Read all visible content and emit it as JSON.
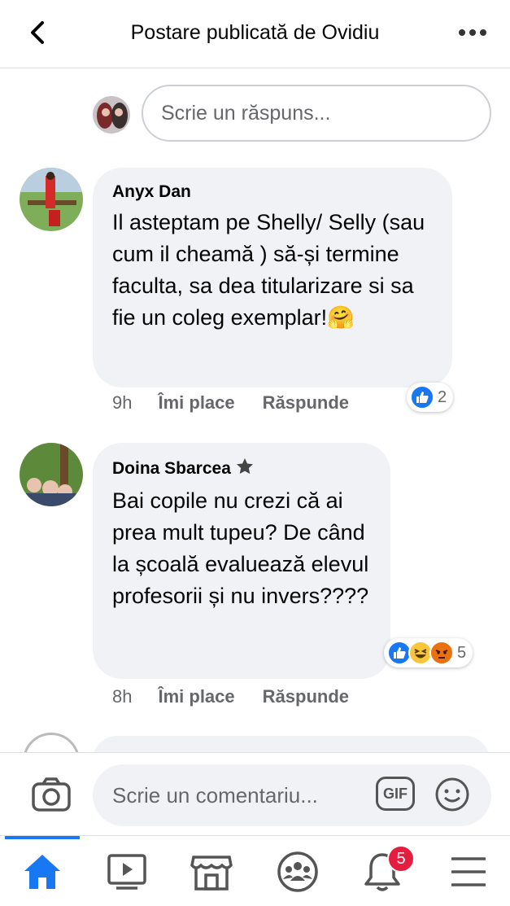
{
  "header": {
    "title": "Postare publicată de Ovidiu"
  },
  "reply": {
    "placeholder": "Scrie un răspuns..."
  },
  "comments": [
    {
      "author": "Anyx Dan",
      "text": "Il asteptam pe Shelly/ Selly (sau cum il cheamă ) să-și termine faculta, sa dea titularizare si sa fie un coleg exemplar!🤗",
      "time": "9h",
      "like_label": "Îmi place",
      "reply_label": "Răspunde",
      "reaction_count": "2",
      "reactions": [
        "like"
      ]
    },
    {
      "author": "Doina Sbarcea",
      "author_badge": "top-fan-star-icon",
      "text": "Bai copile nu crezi că ai prea mult tupeu? De când la școală evaluează elevul profesorii și nu invers????",
      "time": "8h",
      "like_label": "Îmi place",
      "reply_label": "Răspunde",
      "reaction_count": "5",
      "reactions": [
        "like",
        "haha",
        "angry"
      ]
    }
  ],
  "composer": {
    "placeholder": "Scrie un comentariu...",
    "gif_label": "GIF"
  },
  "nav": {
    "notifications_badge": "5"
  },
  "colors": {
    "accent": "#1877f2",
    "bubble": "#f0f2f5",
    "badge": "#e41e3f"
  }
}
